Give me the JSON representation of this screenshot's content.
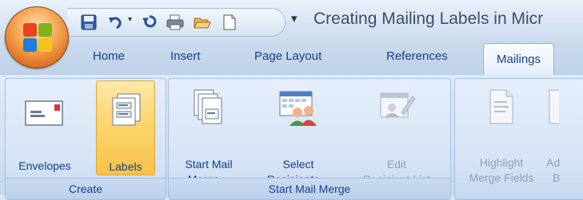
{
  "window": {
    "title": "Creating Mailing Labels in Micr"
  },
  "quick_access": {
    "buttons": [
      "save-icon",
      "undo-icon",
      "redo-icon",
      "quick-print-icon",
      "open-icon",
      "new-icon"
    ],
    "customize": "▾"
  },
  "tabs": [
    {
      "label": "Home"
    },
    {
      "label": "Insert"
    },
    {
      "label": "Page Layout"
    },
    {
      "label": "References"
    },
    {
      "label": "Mailings",
      "active": true
    }
  ],
  "groups": {
    "create": {
      "label": "Create",
      "envelopes": "Envelopes",
      "labels": "Labels"
    },
    "start_mail_merge": {
      "label": "Start Mail Merge",
      "start_mail_merge_line1": "Start Mail",
      "start_mail_merge_line2": "Merge",
      "select_recipients_line1": "Select",
      "select_recipients_line2": "Recipients",
      "edit_list_line1": "Edit",
      "edit_list_line2": "Recipient List"
    },
    "write_insert": {
      "highlight_line1": "Highlight",
      "highlight_line2": "Merge Fields",
      "next_line1": "Ad",
      "next_line2": "B"
    }
  },
  "colors": {
    "accent": "#15428b",
    "highlight": "#fbd56f",
    "ribbon": "#d5e3f5"
  }
}
